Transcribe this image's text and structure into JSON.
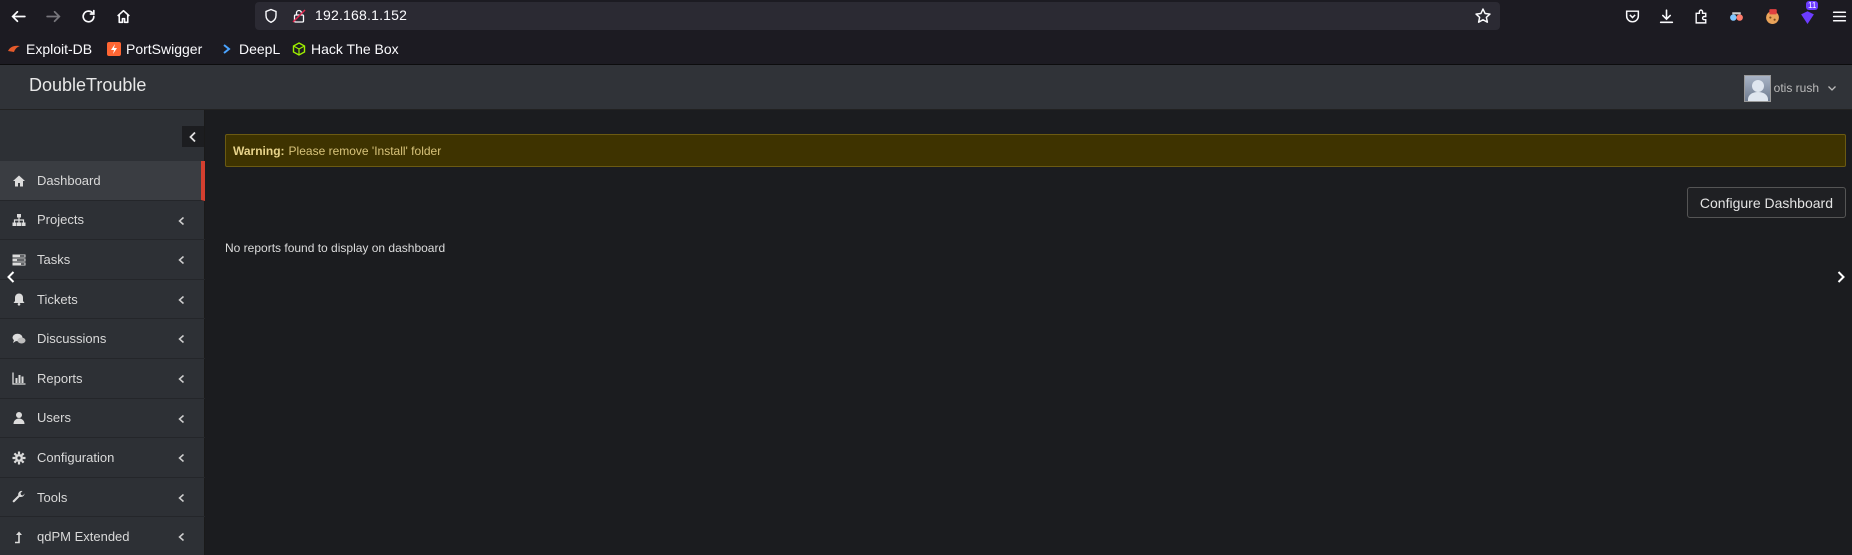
{
  "browser": {
    "url": "192.168.1.152",
    "extension_badge": "11",
    "bookmarks": [
      {
        "label": "Exploit-DB",
        "icon": "exploit-db-icon"
      },
      {
        "label": "PortSwigger",
        "icon": "portswigger-icon"
      },
      {
        "label": "DeepL",
        "icon": "deepl-icon"
      },
      {
        "label": "Hack The Box",
        "icon": "hackthebox-icon"
      }
    ]
  },
  "app": {
    "brand": "DoubleTrouble",
    "user": {
      "name": "otis rush"
    }
  },
  "sidebar": {
    "items": [
      {
        "label": "Dashboard",
        "icon": "home-icon",
        "active": true
      },
      {
        "label": "Projects",
        "icon": "sitemap-icon"
      },
      {
        "label": "Tasks",
        "icon": "tasks-icon"
      },
      {
        "label": "Tickets",
        "icon": "bell-icon"
      },
      {
        "label": "Discussions",
        "icon": "comments-icon"
      },
      {
        "label": "Reports",
        "icon": "bar-chart-icon"
      },
      {
        "label": "Users",
        "icon": "user-icon"
      },
      {
        "label": "Configuration",
        "icon": "gear-icon"
      },
      {
        "label": "Tools",
        "icon": "wrench-icon"
      },
      {
        "label": "qdPM Extended",
        "icon": "level-up-icon"
      }
    ]
  },
  "main": {
    "warning_label": "Warning:",
    "warning_text": "Please remove 'Install' folder",
    "configure_button": "Configure Dashboard",
    "empty_message": "No reports found to display on dashboard"
  },
  "colors": {
    "accent_active": "#d43f2f",
    "warning_bg": "#3e3300",
    "header_bg": "#303338",
    "sidebar_bg": "#2d3035"
  }
}
